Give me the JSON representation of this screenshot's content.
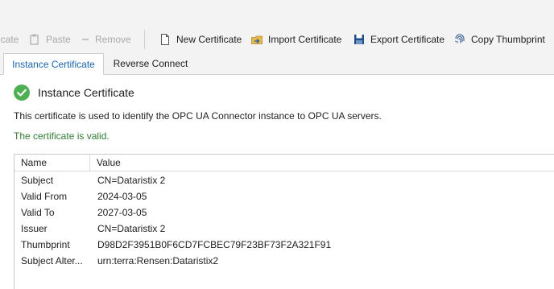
{
  "toolbar": {
    "copy_label": "icate",
    "paste_label": "Paste",
    "remove_label": "Remove",
    "new_label": "New Certificate",
    "import_label": "Import Certificate",
    "export_label": "Export Certificate",
    "thumbprint_label": "Copy Thumbprint",
    "icons": {
      "paste": "paste-icon",
      "remove": "remove-icon",
      "new": "new-document-icon",
      "import": "import-folder-icon",
      "export": "save-disk-icon",
      "thumbprint": "fingerprint-icon"
    }
  },
  "tabs": [
    {
      "label": "Instance Certificate",
      "active": true
    },
    {
      "label": "Reverse Connect",
      "active": false
    }
  ],
  "section": {
    "title": "Instance Certificate",
    "status_icon": "check-circle-icon",
    "description": "This certificate is used to identify the OPC UA Connector instance to OPC UA servers.",
    "status_text": "The certificate is valid."
  },
  "table": {
    "headers": [
      "Name",
      "Value"
    ],
    "rows": [
      {
        "name": "Subject",
        "value": "CN=Dataristix 2"
      },
      {
        "name": "Valid From",
        "value": "2024-03-05"
      },
      {
        "name": "Valid To",
        "value": "2027-03-05"
      },
      {
        "name": "Issuer",
        "value": "CN=Dataristix 2"
      },
      {
        "name": "Thumbprint",
        "value": "D98D2F3951B0F6CD7FCBEC79F23BF73F2A321F91"
      },
      {
        "name": "Subject Alter...",
        "value": "urn:terra:Rensen:Dataristix2"
      }
    ]
  },
  "colors": {
    "accent": "#1565c0",
    "valid": "#2e7d32",
    "check": "#4caf50"
  }
}
